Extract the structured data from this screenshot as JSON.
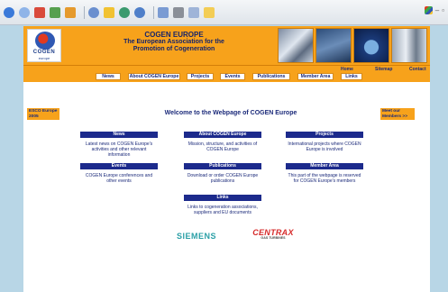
{
  "browser": {
    "toolbar_icons": [
      "back-icon",
      "forward-icon",
      "stop-icon",
      "refresh-icon",
      "home-icon",
      "search-icon",
      "favorites-icon",
      "media-icon",
      "history-icon",
      "mail-icon",
      "print-icon",
      "edit-icon",
      "folder-icon"
    ]
  },
  "header": {
    "logo_text": "COGEN",
    "logo_sub": "europe",
    "title_line1": "COGEN EUROPE",
    "title_line2": "The European Association for the",
    "title_line3": "Promotion of Cogeneration"
  },
  "util_links": [
    "Home",
    "Sitemap",
    "Contact"
  ],
  "nav": [
    "News",
    "About COGEN Europe",
    "Projects",
    "Events",
    "Publications",
    "Member Area",
    "Links"
  ],
  "left_box": "ESCO Europe 2005",
  "right_box": "Meet our Members >>",
  "welcome": "Welcome to the Webpage of COGEN Europe",
  "sections": [
    {
      "title": "News",
      "text": "Latest news on COGEN Europe's activities and other relevant information"
    },
    {
      "title": "About COGEN Europe",
      "text": "Mission, structure, and activities of COGEN Europe"
    },
    {
      "title": "Projects",
      "text": "International projects where COGEN Europe is involved"
    },
    {
      "title": "Events",
      "text": "COGEN Europe conferences and other events"
    },
    {
      "title": "Publications",
      "text": "Download or order COGEN Europe publications"
    },
    {
      "title": "Member Area",
      "text": "This part of the webpage is reserved for COGEN Europe's members"
    },
    {
      "title": "Links",
      "text": "Links to cogeneration associations, suppliers and EU documents"
    }
  ],
  "sponsors": {
    "siemens": "SIEMENS",
    "centrax": "CENTRAX",
    "centrax_sub": "GAS TURBINES"
  },
  "colors": {
    "orange": "#f7a21b",
    "navy": "#1c2a8c",
    "background": "#b8d6e6"
  }
}
